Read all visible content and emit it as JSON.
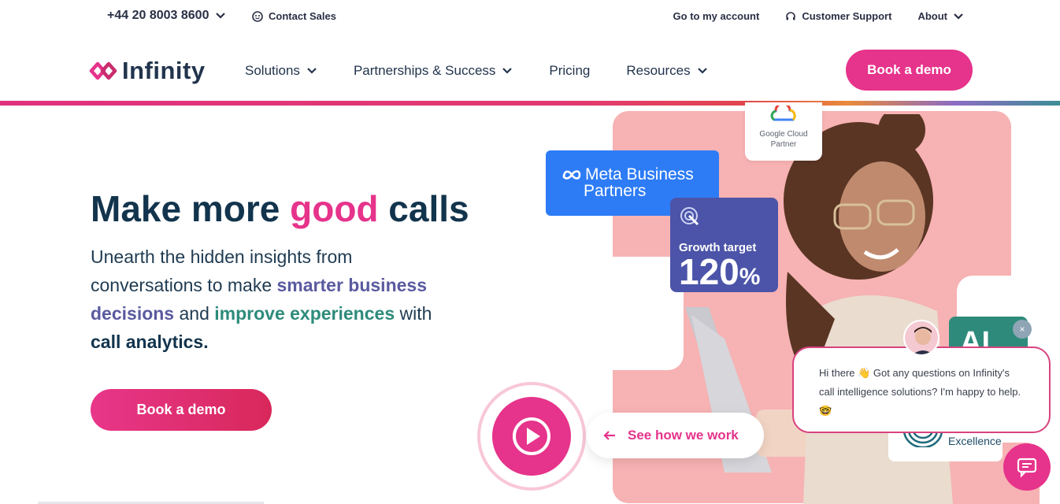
{
  "utility": {
    "phone": "+44 20 8003 8600",
    "contact_sales": "Contact Sales",
    "account": "Go to my account",
    "support": "Customer Support",
    "about": "About"
  },
  "nav": {
    "logo_text": "Infinity",
    "menu": [
      {
        "label": "Solutions",
        "dropdown": true
      },
      {
        "label": "Partnerships & Success",
        "dropdown": true
      },
      {
        "label": "Pricing",
        "dropdown": false
      },
      {
        "label": "Resources",
        "dropdown": true
      }
    ],
    "cta": "Book a demo"
  },
  "hero": {
    "title_part1": "Make more ",
    "title_highlight": "good",
    "title_part2": " calls",
    "sub_part1": "Unearth the hidden insights from conversations to make ",
    "sub_highlight1": "smarter business decisions",
    "sub_part2": " and ",
    "sub_highlight2": "improve experiences",
    "sub_part3": " with ",
    "sub_bold": "call analytics.",
    "cta": "Book a demo"
  },
  "visual": {
    "google_line1": "Google Cloud",
    "google_line2": "Partner",
    "meta_line1": "Meta Business",
    "meta_line2": "Partners",
    "growth_label": "Growth target",
    "growth_number": "120",
    "growth_unit": "%",
    "see_how": "See how we work",
    "ai_text": "AI",
    "excellence_text": "Excellence"
  },
  "chat": {
    "message": "Hi there 👋 Got any questions on Infinity's call intelligence solutions? I'm happy to help. 🤓",
    "close": "×"
  },
  "colors": {
    "brand_pink": "#e6338b",
    "navy": "#12344d",
    "purple": "#5a5aa0",
    "teal": "#2e8b7b",
    "meta_blue": "#2d7cf6",
    "growth_indigo": "#4b54a8"
  }
}
